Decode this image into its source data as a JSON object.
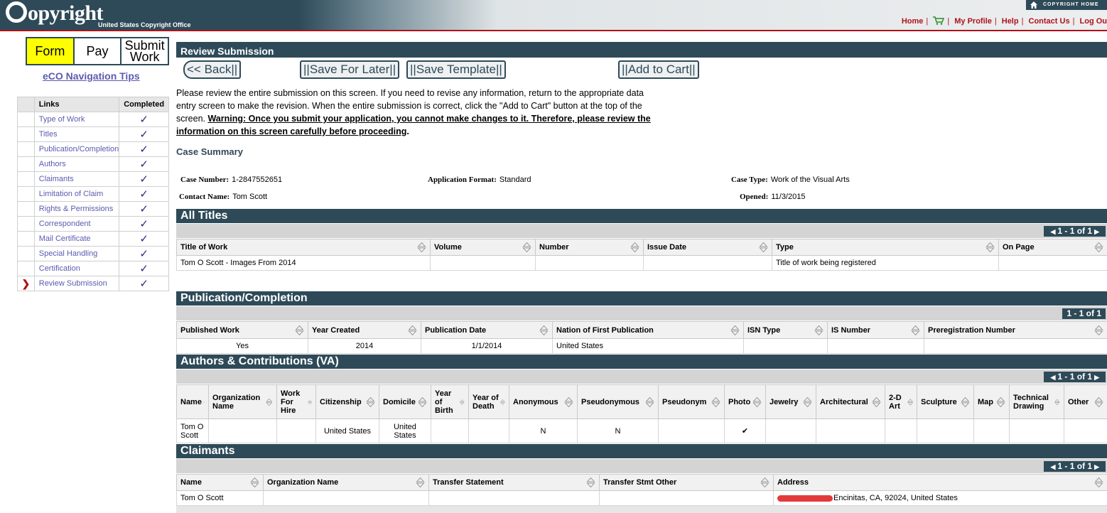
{
  "header": {
    "logo_text": "opyright",
    "logo_sub": "United States Copyright Office",
    "home_link": "COPYRIGHT HOME",
    "nav": [
      "Home",
      "My Profile",
      "Help",
      "Contact Us",
      "Log Ou"
    ]
  },
  "steps": [
    "Form",
    "Pay",
    "Submit Work"
  ],
  "nav_tips": "eCO Navigation Tips",
  "links_table": {
    "headers": [
      "Links",
      "Completed"
    ],
    "items": [
      {
        "label": "Type of Work",
        "check": "✓"
      },
      {
        "label": "Titles",
        "check": "✓"
      },
      {
        "label": "Publication/Completion",
        "check": "✓"
      },
      {
        "label": "Authors",
        "check": "✓"
      },
      {
        "label": "Claimants",
        "check": "✓"
      },
      {
        "label": "Limitation of Claim",
        "check": "✓"
      },
      {
        "label": "Rights & Permissions",
        "check": "✓"
      },
      {
        "label": "Correspondent",
        "check": "✓"
      },
      {
        "label": "Mail Certificate",
        "check": "✓"
      },
      {
        "label": "Special Handling",
        "check": "✓"
      },
      {
        "label": "Certification",
        "check": "✓"
      },
      {
        "label": "Review Submission",
        "check": "✓"
      }
    ]
  },
  "page_title": "Review Submission",
  "buttons": {
    "back": "<< Back||",
    "save_later": "||Save For Later||",
    "save_template": "||Save Template||",
    "add_cart": "||Add to Cart||"
  },
  "instructions": {
    "text": "Please review the entire submission on this screen. If you need to revise any information, return to the appropriate data entry screen to make the revision. When the entire submission is correct, click the \"Add to Cart\" button at the top of the screen. ",
    "warning": "Warning: Once you submit your application, you cannot make changes to it. Therefore, please review the information on this screen carefully before proceeding",
    "end": "."
  },
  "case_summary": {
    "title": "Case Summary",
    "case_number_label": "Case Number:",
    "case_number": "1-2847552651",
    "app_format_label": "Application Format:",
    "app_format": "Standard",
    "case_type_label": "Case Type:",
    "case_type": "Work of the Visual Arts",
    "contact_label": "Contact Name:",
    "contact": "Tom Scott",
    "opened_label": "Opened:",
    "opened": "11/3/2015"
  },
  "titles": {
    "title": "All Titles",
    "pager": "1 - 1 of 1",
    "headers": [
      "Title of Work",
      "Volume",
      "Number",
      "Issue Date",
      "Type",
      "On Page"
    ],
    "rows": [
      [
        "Tom O Scott - Images From 2014",
        "",
        "",
        "",
        "Title of work being registered",
        ""
      ]
    ]
  },
  "publication": {
    "title": "Publication/Completion",
    "pager": "1 - 1 of 1",
    "headers": [
      "Published Work",
      "Year Created",
      "Publication Date",
      "Nation of First Publication",
      "ISN Type",
      "IS Number",
      "Preregistration Number"
    ],
    "rows": [
      [
        "Yes",
        "2014",
        "1/1/2014",
        "United States",
        "",
        "",
        ""
      ]
    ]
  },
  "authors": {
    "title": "Authors & Contributions (VA)",
    "pager": "1 - 1 of 1",
    "headers": [
      "Name",
      "Organization Name",
      "Work For Hire",
      "Citizenship",
      "Domicile",
      "Year of Birth",
      "Year of Death",
      "Anonymous",
      "Pseudonymous",
      "Pseudonym",
      "Photo",
      "Jewelry",
      "Architectural",
      "2-D Art",
      "Sculpture",
      "Map",
      "Technical Drawing",
      "Other"
    ],
    "rows": [
      [
        "Tom O Scott",
        "",
        "",
        "United States",
        "United States",
        "",
        "",
        "N",
        "N",
        "",
        "✔",
        "",
        "",
        "",
        "",
        "",
        "",
        ""
      ]
    ]
  },
  "claimants": {
    "title": "Claimants",
    "pager": "1 - 1 of 1",
    "headers": [
      "Name",
      "Organization Name",
      "Transfer Statement",
      "Transfer Stmt Other",
      "Address"
    ],
    "rows": [
      [
        "Tom O Scott",
        "",
        "",
        "",
        "Encinitas, CA, 92024, United States"
      ]
    ]
  }
}
